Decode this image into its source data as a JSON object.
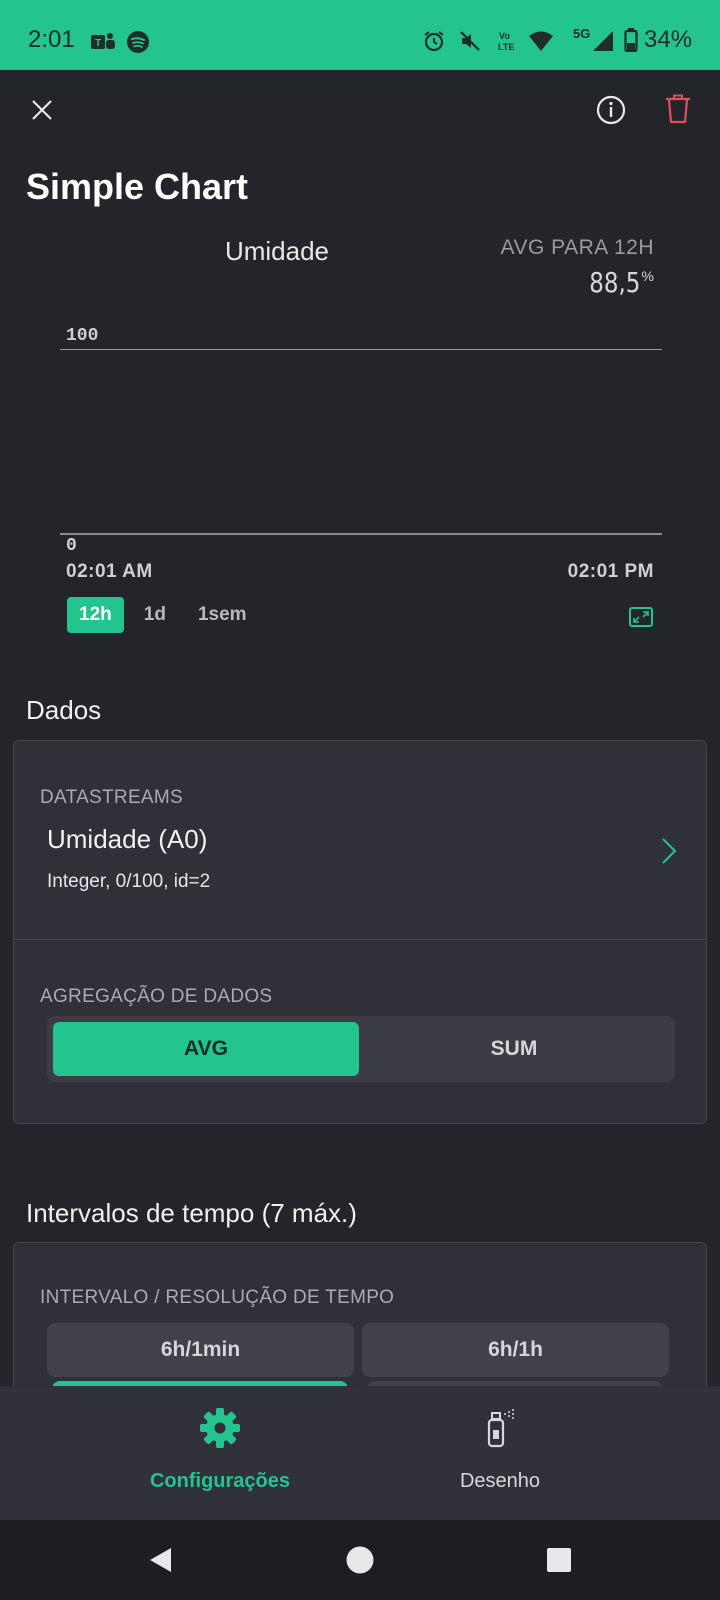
{
  "status_bar": {
    "time": "2:01",
    "battery": "34%",
    "network": "5G",
    "icons": [
      "teams-icon",
      "spotify-icon",
      "alarm-icon",
      "mute-icon",
      "volte-icon",
      "wifi-icon",
      "signal-icon",
      "battery-icon"
    ]
  },
  "header": {
    "title": "Simple Chart",
    "close_icon": "close-icon",
    "info_icon": "info-icon",
    "delete_icon": "trash-icon"
  },
  "chart": {
    "title": "Umidade",
    "avg_label": "AVG PARA 12H",
    "avg_value": "88,5",
    "avg_unit": "%",
    "y_top_tick": "100",
    "y_bottom_tick": "0",
    "x_start": "02:01 AM",
    "x_end": "02:01 PM",
    "ranges": [
      {
        "label": "12h",
        "active": true
      },
      {
        "label": "1d",
        "active": false
      },
      {
        "label": "1sem",
        "active": false
      }
    ],
    "accent": "#23c48e"
  },
  "chart_data": {
    "type": "line",
    "title": "Umidade",
    "x": [
      "02:01 AM",
      "02:01 PM"
    ],
    "series": [],
    "ylim": [
      0,
      100
    ],
    "grid": true
  },
  "dados": {
    "section_title": "Dados",
    "datastreams_caption": "DATASTREAMS",
    "datastream_name": "Umidade (A0)",
    "datastream_meta": "Integer, 0/100, id=2",
    "aggregation_caption": "AGREGAÇÃO DE DADOS",
    "aggregation_options": [
      {
        "label": "AVG",
        "active": true
      },
      {
        "label": "SUM",
        "active": false
      }
    ]
  },
  "intervals": {
    "section_title": "Intervalos de tempo (7 máx.)",
    "caption": "INTERVALO / RESOLUÇÃO DE TEMPO",
    "options": [
      "6h/1min",
      "6h/1h"
    ]
  },
  "tabbar": {
    "tabs": [
      {
        "label": "Configurações",
        "icon": "gear-icon",
        "active": true
      },
      {
        "label": "Desenho",
        "icon": "spray-paint-icon",
        "active": false
      }
    ]
  },
  "colors": {
    "accent": "#23c48e",
    "background": "#24252a",
    "card": "#2f3038",
    "danger": "#e0505a"
  }
}
